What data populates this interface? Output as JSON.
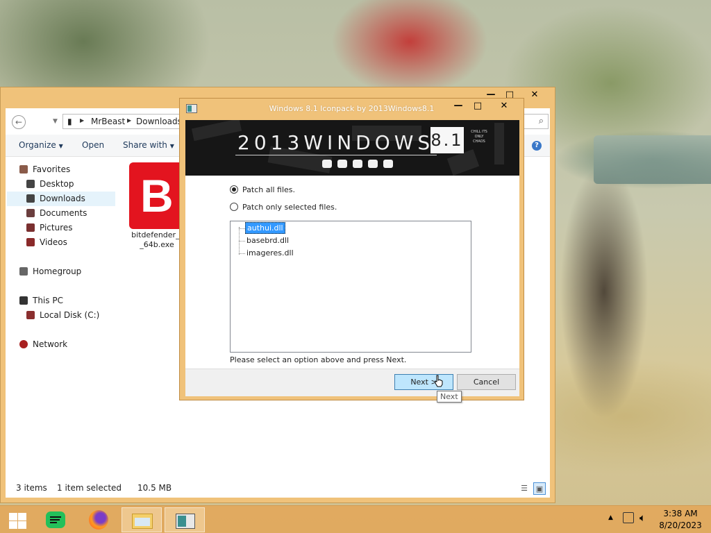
{
  "explorer": {
    "caption_buttons": {
      "minimize": "—",
      "maximize": "□",
      "close": "✕"
    },
    "breadcrumb": [
      "MrBeast",
      "Downloads"
    ],
    "ribbon": {
      "organize": "Organize",
      "open": "Open",
      "share_with": "Share with"
    },
    "nav": {
      "favorites": "Favorites",
      "desktop": "Desktop",
      "downloads": "Downloads",
      "documents": "Documents",
      "pictures": "Pictures",
      "videos": "Videos",
      "homegroup": "Homegroup",
      "this_pc": "This PC",
      "local_disk": "Local Disk (C:)",
      "network": "Network"
    },
    "file": {
      "icon_letter": "B",
      "name_line1": "bitdefender_t",
      "name_line2": "_64b.exe"
    },
    "status": {
      "items": "3 items",
      "selected": "1 item selected",
      "size": "10.5 MB"
    }
  },
  "dialog": {
    "title": "Windows 8.1 Iconpack by 2013Windows8.1",
    "banner_title": "2013WINDOWS",
    "banner_version": "8.1",
    "banner_side_text": "CHILL ITS ONLY CHAOS",
    "option_all": "Patch all files.",
    "option_selected": "Patch only selected files.",
    "selected_option": "all",
    "files": [
      {
        "name": "authui.dll",
        "selected": true
      },
      {
        "name": "basebrd.dll",
        "selected": false
      },
      {
        "name": "imageres.dll",
        "selected": false
      }
    ],
    "hint": "Please select an option above and press Next.",
    "next_label": "Next >",
    "cancel_label": "Cancel",
    "tooltip": "Next"
  },
  "taskbar": {
    "time": "3:38 AM",
    "date": "8/20/2023"
  },
  "colors": {
    "accent_frame": "#f0c27a",
    "taskbar": "#e2a85c",
    "selection": "#3399ff",
    "primary_button": "#bee6fd"
  }
}
